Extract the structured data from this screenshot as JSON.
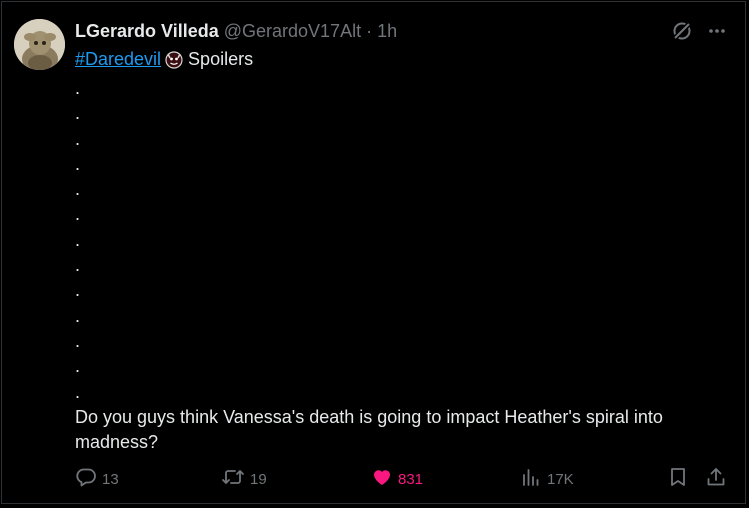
{
  "author": {
    "name": "LGerardo Villeda",
    "handle": "@GerardoV17Alt",
    "separator": "·",
    "time": "1h"
  },
  "post": {
    "hashtag": "#Daredevil",
    "spoiler_label": "Spoilers",
    "dots": [
      ".",
      ".",
      ".",
      ".",
      ".",
      ".",
      ".",
      ".",
      ".",
      ".",
      ".",
      ".",
      "."
    ],
    "question": "Do you guys think Vanessa's death is going to impact Heather's spiral into madness?"
  },
  "actions": {
    "replies": "13",
    "reposts": "19",
    "likes": "831",
    "views": "17K"
  },
  "icons": {
    "grok": "grok-icon",
    "more": "more-icon",
    "reply": "reply-icon",
    "repost": "repost-icon",
    "like": "heart-icon",
    "views": "views-icon",
    "bookmark": "bookmark-icon",
    "share": "share-icon"
  },
  "colors": {
    "background": "#000000",
    "text": "#e7e9ea",
    "muted": "#71767b",
    "link": "#1d9bf0",
    "like": "#f91880",
    "border": "#2f3336"
  }
}
